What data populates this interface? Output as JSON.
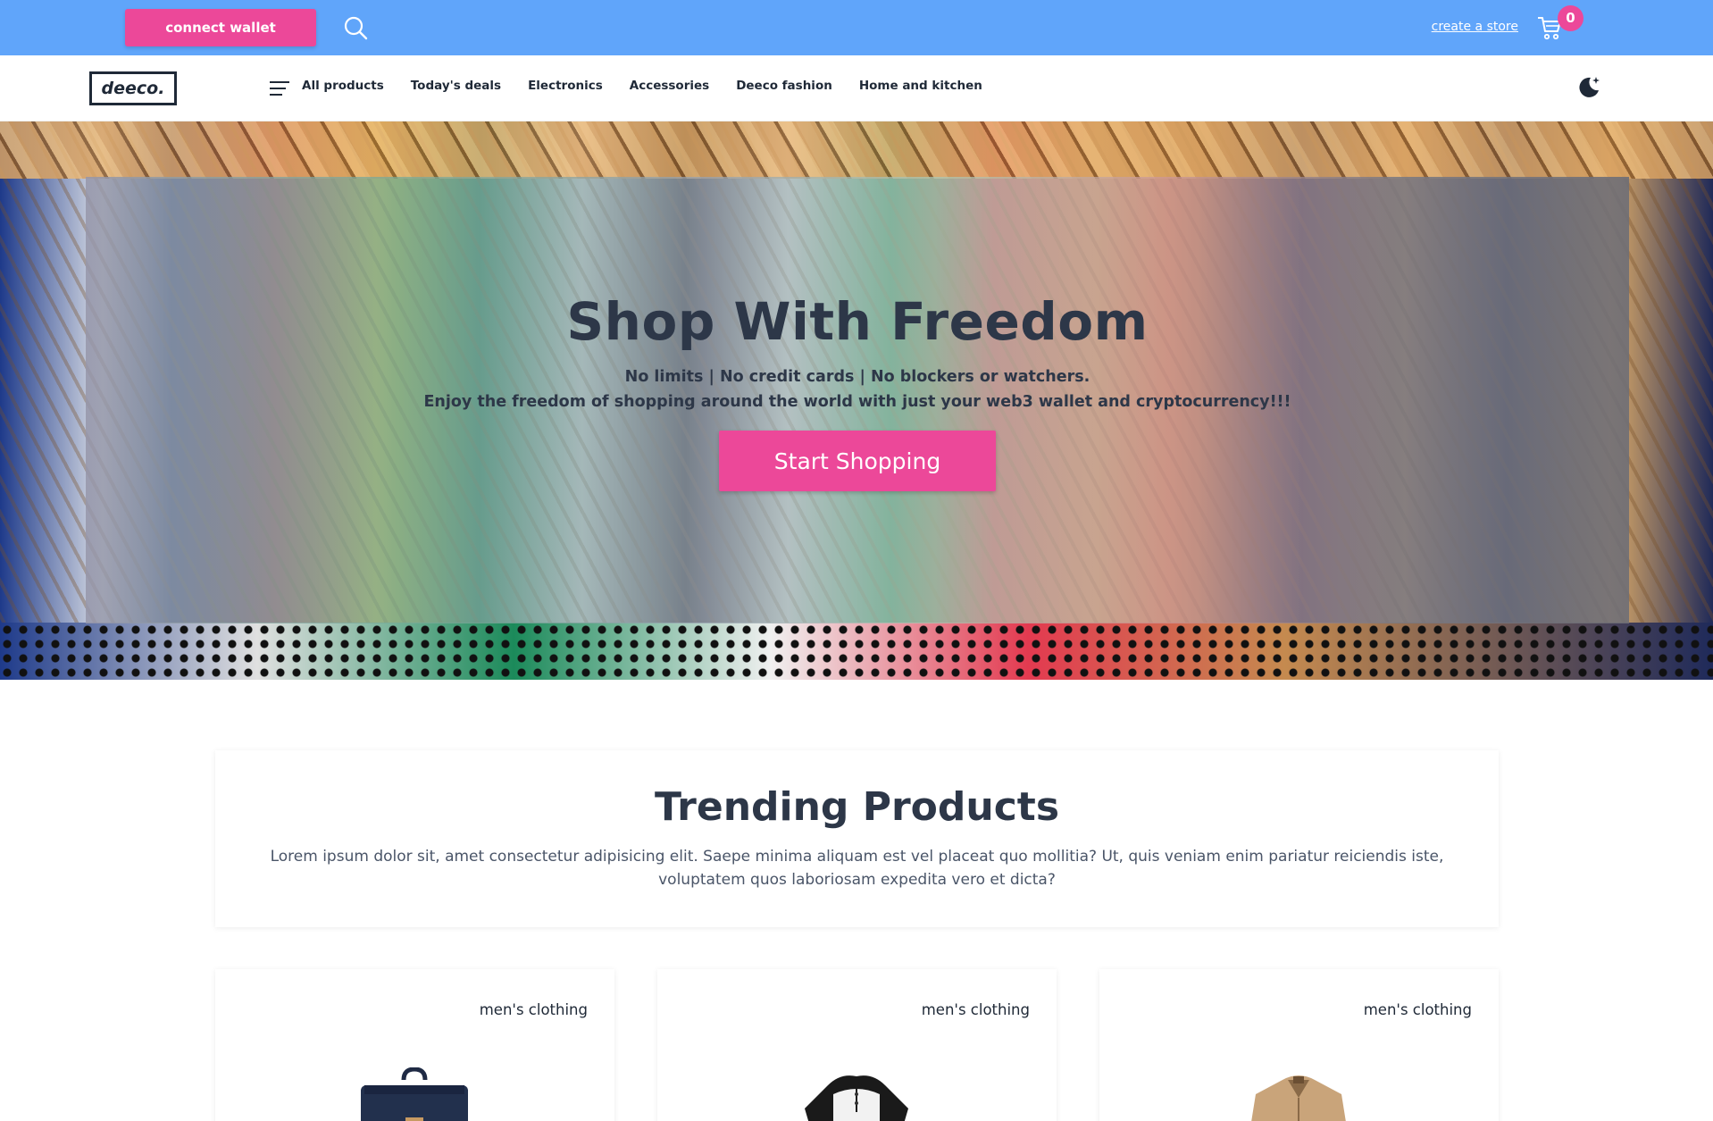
{
  "topbar": {
    "connect_label": "connect wallet",
    "create_store_label": "create a store",
    "cart_count": "0",
    "icons": [
      "search-icon",
      "cart-icon"
    ]
  },
  "nav": {
    "logo_text": "deeco.",
    "links": [
      "All products",
      "Today's deals",
      "Electronics",
      "Accessories",
      "Deeco fashion",
      "Home and kitchen"
    ],
    "icons": [
      "menu-icon",
      "moon-icon"
    ]
  },
  "hero": {
    "title": "Shop With Freedom",
    "subtitle_1": "No limits | No credit cards | No blockers or watchers.",
    "subtitle_2": "Enjoy the freedom of shopping around the world with just your web3 wallet and cryptocurrency!!!",
    "cta_label": "Start Shopping"
  },
  "trending": {
    "title": "Trending Products",
    "description": "Lorem ipsum dolor sit, amet consectetur adipisicing elit. Saepe minima aliquam est vel placeat quo mollitia? Ut, quis veniam enim pariatur reiciendis iste, voluptatem quos laboriosam expedita vero et dicta?"
  },
  "products": [
    {
      "category": "men's clothing",
      "image": "backpack"
    },
    {
      "category": "men's clothing",
      "image": "t-shirt"
    },
    {
      "category": "men's clothing",
      "image": "jacket"
    }
  ],
  "colors": {
    "topbar": "#60a5fa",
    "accent": "#ec4899",
    "text": "#2d3748"
  }
}
